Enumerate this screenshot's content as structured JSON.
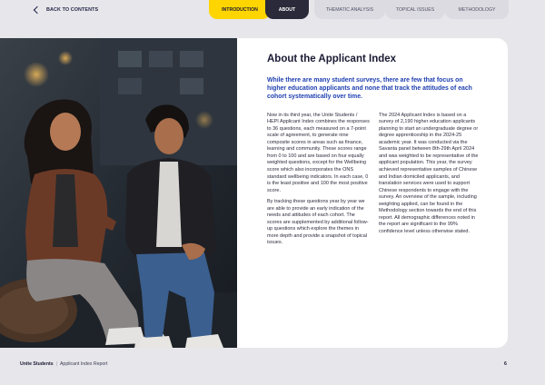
{
  "nav": {
    "back_label": "BACK TO CONTENTS",
    "tabs": [
      "INTRODUCTION",
      "ABOUT",
      "THEMATIC ANALYSIS",
      "TOPICAL ISSUES",
      "METHODOLOGY"
    ],
    "active_tab": "ABOUT"
  },
  "article": {
    "title": "About the Applicant Index",
    "lead": "While there are many student surveys, there are few that focus on higher education applicants and none that track the attitudes of each cohort systematically over time.",
    "col1_p1": "Now in its third year, the Unite Students / HEPI Applicant Index combines the responses to 36 questions, each measured on a 7-point scale of agreement, to generate nine composite scores in areas such as finance, learning and community. These scores range from 0 to 100 and are based on four equally weighted questions, except for the Wellbeing score which also incorporates the ONS standard wellbeing indicators. In each case, 0 is the least positive and 100 the most positive score.",
    "col1_p2": "By tracking these questions year by year we are able to provide an early indication of the needs and attitudes of each cohort. The scores are supplemented by additional follow-up questions which explore the themes in more depth and provide a snapshot of topical issues.",
    "col2_p1": "The 2024 Applicant Index is based on a survey of 2,190 higher education applicants planning to start an undergraduate degree or degree apprenticeship in the 2024-25 academic year. It was conducted via the Savanta panel between 8th-29th April 2024 and was weighted to be representative of the applicant population. This year, the survey achieved representative samples of Chinese and Indian domiciled applicants, and translation services were used to support Chinese respondents to engage with the survey. An overview of the sample, including weighting applied, can be found in the Methodology section towards the end of this report. All demographic differences noted in the report are significant to the 99% confidence level unless otherwise stated."
  },
  "footer": {
    "brand": "Unite Students",
    "separator": "|",
    "report": "Applicant Index Report",
    "page": "6"
  },
  "colors": {
    "accent_yellow": "#ffd500",
    "active_tab_bg": "#2b2a3a",
    "lead_blue": "#1f3fb0",
    "page_bg": "#e7e6ea"
  }
}
